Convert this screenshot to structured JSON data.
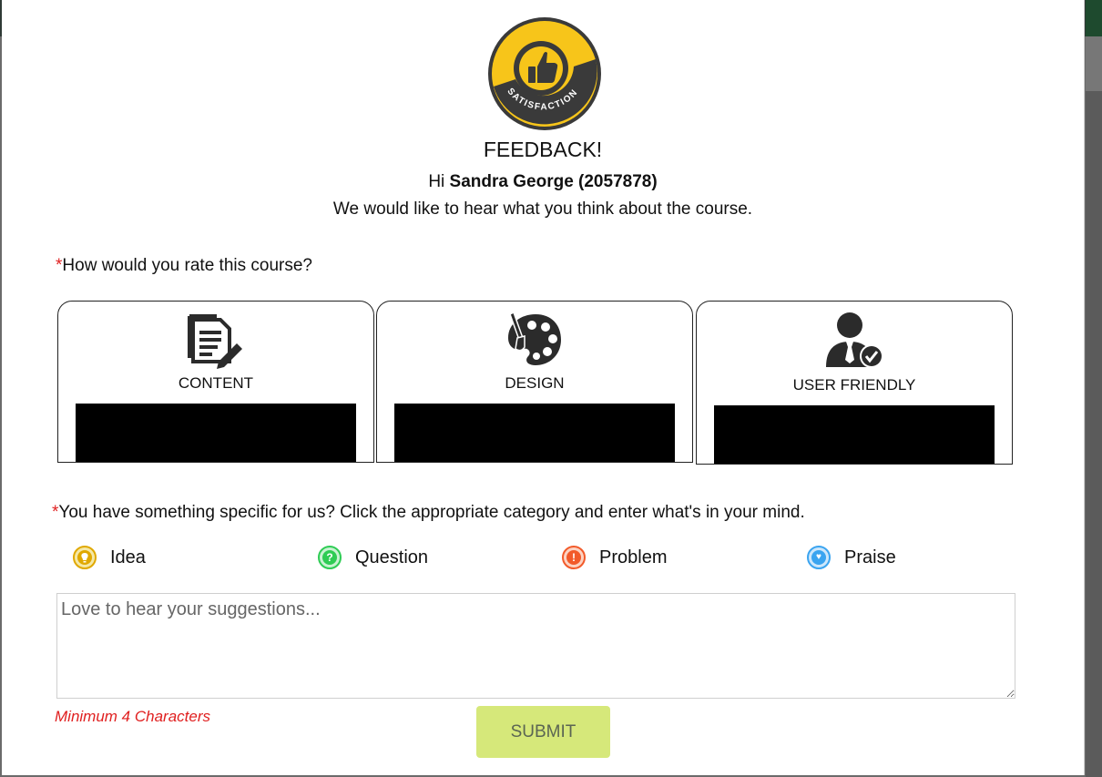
{
  "logo": {
    "ring_text": "SATISFACTION",
    "icon": "thumbs-up-icon",
    "colors": {
      "yellow": "#f7c51a",
      "dark": "#3a3a3a"
    }
  },
  "header": {
    "title": "FEEDBACK!",
    "greeting_prefix": "Hi",
    "user_name": "Sandra George (2057878)",
    "subtitle": "We would like to hear what you think about the course."
  },
  "rating": {
    "required_mark": "*",
    "question": "How would you rate this course?",
    "cards": [
      {
        "label": "CONTENT",
        "icon": "document-pen-icon"
      },
      {
        "label": "DESIGN",
        "icon": "palette-icon"
      },
      {
        "label": "USER FRIENDLY",
        "icon": "user-check-icon"
      }
    ]
  },
  "feedback": {
    "required_mark": "*",
    "question": "You have something specific for us? Click the appropriate category and enter what's in your mind.",
    "categories": [
      {
        "label": "Idea",
        "icon": "lightbulb-icon",
        "color": "#e0a800"
      },
      {
        "label": "Question",
        "icon": "question-icon",
        "color": "#2ecc54"
      },
      {
        "label": "Problem",
        "icon": "exclamation-icon",
        "color": "#f25a2a"
      },
      {
        "label": "Praise",
        "icon": "heart-icon",
        "color": "#3aa4f0"
      }
    ],
    "placeholder": "Love to hear your suggestions...",
    "value": "",
    "hint": "Minimum 4 Characters",
    "submit_label": "SUBMIT"
  },
  "colors": {
    "required": "#e02020",
    "submit_bg": "#d6e87a"
  }
}
